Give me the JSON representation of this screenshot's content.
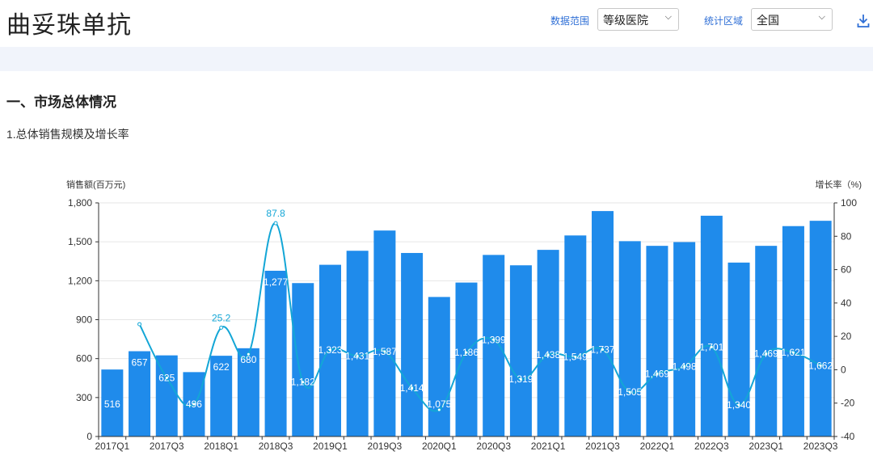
{
  "header": {
    "title": "曲妥珠单抗",
    "data_range_label": "数据范围",
    "data_range_value": "等级医院",
    "region_label": "统计区域",
    "region_value": "全国",
    "download_icon": "download-icon"
  },
  "section": {
    "title": "一、市场总体情况",
    "subtitle": "1.总体销售规模及增长率"
  },
  "chart_data": {
    "type": "bar",
    "ylabel": "销售额(百万元)",
    "y2label": "增长率（%)",
    "ylim": [
      0,
      1800
    ],
    "y2lim": [
      -40,
      100
    ],
    "yticks": [
      "0",
      "300",
      "600",
      "900",
      "1,200",
      "1,500",
      "1,800"
    ],
    "y2ticks": [
      "-40",
      "-20",
      "0",
      "20",
      "40",
      "60",
      "80",
      "100"
    ],
    "categories": [
      "2017Q1",
      "2017Q2",
      "2017Q3",
      "2017Q4",
      "2018Q1",
      "2018Q2",
      "2018Q3",
      "2018Q4",
      "2019Q1",
      "2019Q2",
      "2019Q3",
      "2019Q4",
      "2020Q1",
      "2020Q2",
      "2020Q3",
      "2020Q4",
      "2021Q1",
      "2021Q2",
      "2021Q3",
      "2021Q4",
      "2022Q1",
      "2022Q2",
      "2022Q3",
      "2022Q4",
      "2023Q1",
      "2023Q2",
      "2023Q3"
    ],
    "x_tick_labels": [
      "2017Q1",
      "2017Q3",
      "2018Q1",
      "2018Q3",
      "2019Q1",
      "2019Q3",
      "2020Q1",
      "2020Q3",
      "2021Q1",
      "2021Q3",
      "2022Q1",
      "2022Q3",
      "2023Q1",
      "2023Q3"
    ],
    "values": [
      516,
      657,
      625,
      496,
      622,
      680,
      1277,
      1182,
      1323,
      1431,
      1587,
      1414,
      1075,
      1186,
      1399,
      1319,
      1438,
      1549,
      1737,
      1505,
      1469,
      1498,
      1701,
      1340,
      1469,
      1621,
      1662
    ],
    "value_labels": [
      "516",
      "657",
      "625",
      "496",
      "622",
      "680",
      "1,277",
      "1,182",
      "1,323",
      "1,431",
      "1,587",
      "1,414",
      "1,075",
      "1,186",
      "1,399",
      "1,319",
      "1,438",
      "1,549",
      "1,737",
      "1,505",
      "1,469",
      "1,498",
      "1,701",
      "1,340",
      "1,469",
      "1,621",
      "1,662"
    ],
    "growth": [
      null,
      27.3,
      -4.9,
      -20.6,
      25.2,
      9.3,
      87.8,
      -7.4,
      11.9,
      8.2,
      10.9,
      -10.9,
      -24.0,
      10.3,
      18.0,
      -5.7,
      9.0,
      7.7,
      12.1,
      -13.4,
      -2.4,
      2.0,
      13.6,
      -21.2,
      9.6,
      10.3,
      2.5
    ],
    "annotations": [
      {
        "index": 4,
        "label": "25.2"
      },
      {
        "index": 6,
        "label": "87.8"
      }
    ],
    "colors": {
      "bar": "#1f8beb",
      "line": "#13a6d6",
      "annotation": "#13a6d6",
      "grid": "#e6e6e6",
      "axis": "#333333"
    }
  }
}
